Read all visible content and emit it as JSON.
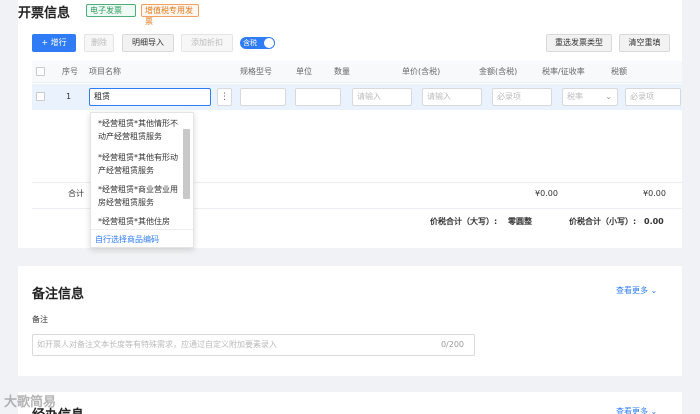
{
  "invoice_section": {
    "title": "开票信息",
    "tag_electronic": "电子发票",
    "tag_vat_special": "增值税专用发票"
  },
  "toolbar": {
    "add_row": "+ 增行",
    "delete": "删除",
    "import_detail": "明细导入",
    "add_discount": "添加折扣",
    "tax_included": "含税",
    "reselect_invoice_type": "重选发票类型",
    "clear_all": "清空重填"
  },
  "table": {
    "headers": {
      "index": "序号",
      "item_name": "项目名称",
      "spec_model": "规格型号",
      "unit": "单位",
      "quantity": "数量",
      "unit_price": "单价(含税)",
      "amount": "金额(含税)",
      "tax_rate": "税率/征收率",
      "tax": "税额"
    },
    "row": {
      "index": "1",
      "item_name": "租赁",
      "quantity_ph": "请输入",
      "unit_price_ph": "请输入",
      "amount_ph": "必录项",
      "tax_rate_ph": "税率",
      "tax_ph": "必录项"
    },
    "total_label": "合计",
    "total_amount": "¥0.00",
    "total_tax": "¥0.00",
    "sum_upper_label": "价税合计（大写）:",
    "sum_upper_value": "零圆整",
    "sum_lower_label": "价税合计（小写）:",
    "sum_lower_value": "0.00"
  },
  "dropdown": {
    "options": [
      "*经营租赁*其他情形不动产经营租赁服务",
      "*经营租赁*其他有形动产经营租赁服务",
      "*经营租赁*商业营业用房经营租赁服务",
      "*经营租赁*其他住房"
    ],
    "custom_link": "自行选择商品编码"
  },
  "remark_section": {
    "title": "备注信息",
    "view_more": "查看更多 ⌄",
    "field_label": "备注",
    "placeholder": "如开票人对备注文本长度等有特殊需求，应通过自定义附加要素录入",
    "counter": "0/200"
  },
  "agent_section": {
    "title": "经办信息",
    "view_more": "查看更多 ⌄"
  },
  "watermark": "大歌简易"
}
